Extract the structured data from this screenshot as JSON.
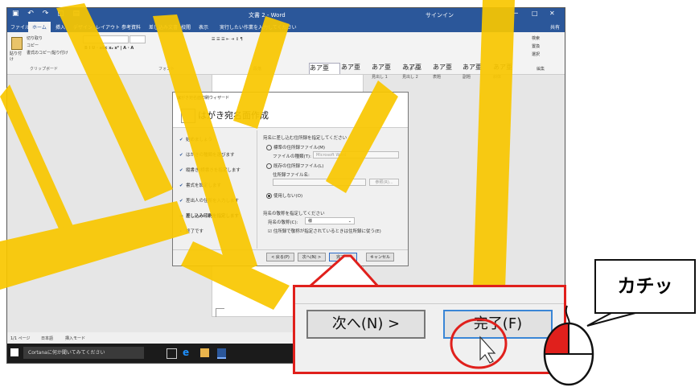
{
  "window": {
    "doc_title": "文書 2 - Word",
    "signin": "サインイン",
    "search_hint": "実行したい作業を入力してください",
    "share": "共有"
  },
  "tabs": [
    "ファイル",
    "ホーム",
    "挿入",
    "デザイン",
    "レイアウト",
    "参考資料",
    "差し込み文書",
    "校閲",
    "表示"
  ],
  "ribbon": {
    "clipboard": {
      "paste": "貼り付け",
      "cut": "切り取り",
      "copy": "コピー",
      "format_painter": "書式のコピー/貼り付け",
      "group": "クリップボード"
    },
    "font_group": "フォント",
    "paragraph_group": "段落",
    "styles_group": "スタイル",
    "editing_group": "編集",
    "styles": [
      {
        "sample": "あア亜",
        "name": "標準"
      },
      {
        "sample": "あア亜",
        "name": "行間詰め"
      },
      {
        "sample": "あア亜",
        "name": "見出し 1"
      },
      {
        "sample": "あア亜",
        "name": "見出し 2"
      },
      {
        "sample": "あア亜",
        "name": "表題"
      },
      {
        "sample": "あア亜",
        "name": "副題"
      },
      {
        "sample": "あア亜",
        "name": "斜体"
      }
    ],
    "find": "検索",
    "replace": "置換",
    "select": "選択"
  },
  "dialog": {
    "window_title": "はがき宛名面印刷ウィザード",
    "heading": "はがき宛名面作成",
    "steps": [
      {
        "label": "始めましょう",
        "mark": "✔"
      },
      {
        "label": "はがきの種類を選びます",
        "mark": "✔"
      },
      {
        "label": "縦書き/横書きを指定します",
        "mark": "✔"
      },
      {
        "label": "書式を設定します",
        "mark": "✔"
      },
      {
        "label": "差出人の住所を入力します",
        "mark": "✔"
      },
      {
        "label": "差し込み印刷を指定します",
        "mark": "→"
      },
      {
        "label": "終了です",
        "mark": "•"
      }
    ],
    "address_section": "宛名に差し込む住所録を指定してください",
    "opt_standard": "標準の住所録ファイル(M)",
    "file_type_label": "ファイルの種類(T):",
    "file_type_value": "Microsoft Word",
    "opt_existing": "既存の住所録ファイル(L)",
    "file_name_label": "住所録ファイル名:",
    "browse_button": "参照(R)...",
    "opt_none": "使用しない(O)",
    "honorific_section": "宛名の敬称を指定してください",
    "honorific_label": "宛名の敬称(C):",
    "honorific_value": "様",
    "checkbox_label": "住所録で敬称が指定されているときは住所録に従う(E)",
    "back_button": "< 戻る(P)",
    "next_button": "次へ(N) >",
    "finish_button": "完了(F)",
    "cancel_button": "キャンセル"
  },
  "statusbar": {
    "page": "1/1 ページ",
    "lang": "日本語",
    "mode": "挿入モード"
  },
  "taskbar": {
    "cortana": "Cortanaに何か聞いてみてください"
  },
  "zoom": {
    "next_button": "次へ(N) >",
    "finish_button": "完了(F)"
  },
  "bubble": {
    "text": "カチッ"
  },
  "colors": {
    "word_blue": "#2b579a",
    "accent_red": "#e0201c",
    "deco_yellow": "#f9c700",
    "mouse_red": "#e0201c"
  }
}
